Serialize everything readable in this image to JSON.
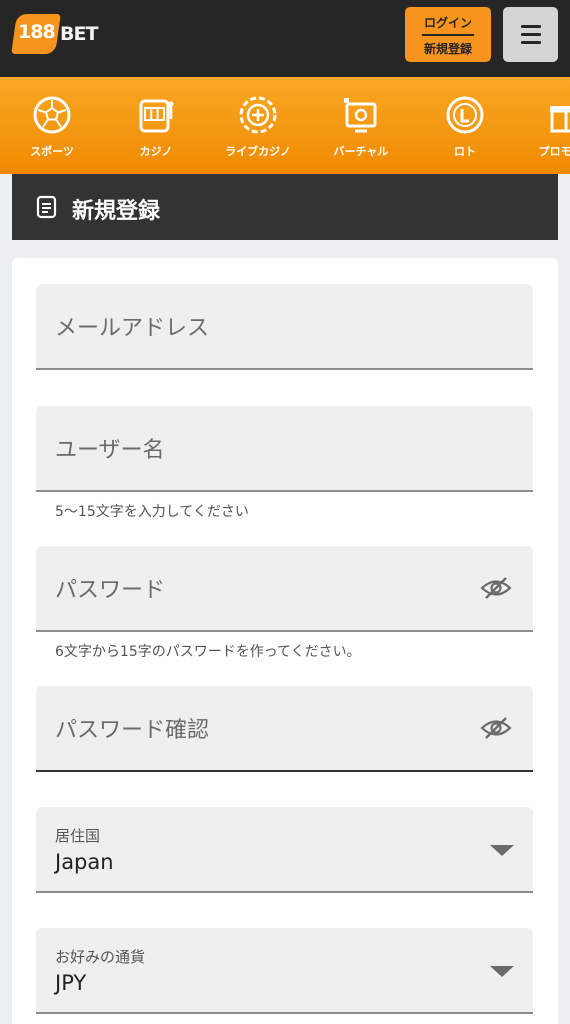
{
  "header": {
    "logo_number": "188",
    "logo_text": "BET",
    "login_label": "ログイン",
    "register_label": "新規登録",
    "menu_icon": "hamburger-icon"
  },
  "nav": {
    "items": [
      {
        "label": "スポーツ",
        "icon": "soccer-ball-icon"
      },
      {
        "label": "カジノ",
        "icon": "slot-machine-icon"
      },
      {
        "label": "ライブカジノ",
        "icon": "casino-chip-icon"
      },
      {
        "label": "バーチャル",
        "icon": "virtual-screen-icon"
      },
      {
        "label": "ロト",
        "icon": "lotto-ball-icon"
      },
      {
        "label": "プロモーシ",
        "icon": "promotion-icon"
      }
    ]
  },
  "page": {
    "title": "新規登録",
    "title_icon": "document-icon"
  },
  "form": {
    "email_placeholder": "メールアドレス",
    "username_placeholder": "ユーザー名",
    "username_help": "5～15文字を入力してください",
    "password_placeholder": "パスワード",
    "password_help": "6文字から15字のパスワードを作ってください。",
    "confirm_placeholder": "パスワード確認",
    "country_label": "居住国",
    "country_value": "Japan",
    "currency_label": "お好みの通貨",
    "currency_value": "JPY"
  },
  "colors": {
    "brand_orange": "#f7941d",
    "header_dark": "#262626"
  }
}
